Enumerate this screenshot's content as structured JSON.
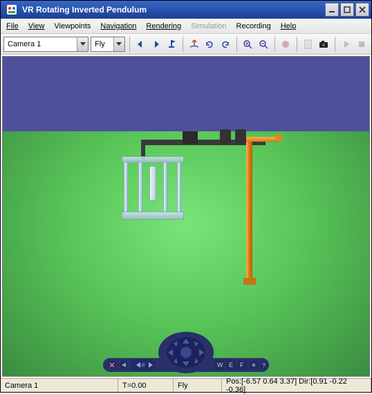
{
  "window": {
    "title": "VR Rotating Inverted Pendulum"
  },
  "menu": {
    "file": "File",
    "view": "View",
    "viewpoints": "Viewpoints",
    "navigation": "Navigation",
    "rendering": "Rendering",
    "simulation": "Simulation",
    "recording": "Recording",
    "help": "Help"
  },
  "toolbar": {
    "camera_label": "Camera 1",
    "navmode_label": "Fly",
    "icons": {
      "back": "back-arrow",
      "fwd": "forward-arrow",
      "flag": "flag",
      "home": "home-axes",
      "undo": "undo-rot",
      "redo": "redo-rot",
      "zoom_in": "zoom-in",
      "zoom_out": "zoom-out",
      "record": "record",
      "clipboard": "clipboard",
      "snapshot": "camera",
      "play": "play",
      "stop": "stop"
    }
  },
  "navpanel": {
    "labels": {
      "w": "W",
      "e": "E",
      "f": "F"
    }
  },
  "status": {
    "camera": "Camera 1",
    "time": "T=0.00",
    "mode": "Fly",
    "pose": "Pos:[-6.57 0.64 3.37] Dir:[0.91 -0.22 -0.36]"
  }
}
